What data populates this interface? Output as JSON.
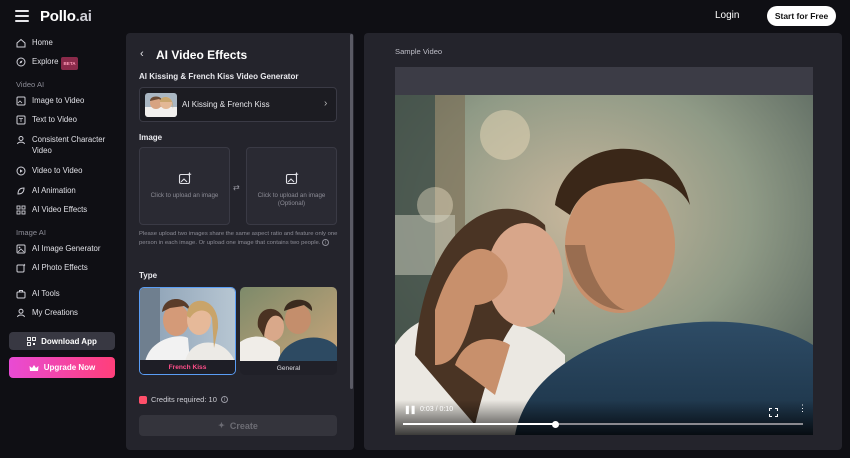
{
  "header": {
    "logo_main": "Pollo",
    "logo_tld": ".ai",
    "login": "Login",
    "start": "Start for Free"
  },
  "sidebar": {
    "home": "Home",
    "explore": "Explore",
    "beta": "BETA",
    "video_ai_label": "Video AI",
    "video_items": [
      "Image to Video",
      "Text to Video",
      "Consistent Character",
      "Video",
      "Video to Video",
      "AI Animation",
      "AI Video Effects"
    ],
    "image_ai_label": "Image AI",
    "image_items": [
      "AI Image Generator",
      "AI Photo Effects"
    ],
    "ai_tools": "AI Tools",
    "my_creations": "My Creations",
    "download": "Download App",
    "upgrade": "Upgrade Now"
  },
  "panel": {
    "back_icon": "‹",
    "title": "AI Video Effects",
    "generator_title": "AI Kissing & French Kiss Video Generator",
    "selector_label": "AI Kissing & French Kiss",
    "image_label": "Image",
    "upload1": "Click to upload an image",
    "upload2_line1": "Click to upload an image",
    "upload2_line2": "(Optional)",
    "hint": "Please upload two images share the same aspect ratio and feature only one person in each image. Or upload one image that contains two people.",
    "type_label": "Type",
    "types": [
      "French Kiss",
      "General"
    ],
    "selected_type": "French Kiss",
    "credits": "Credits required: 10",
    "create": "Create"
  },
  "sample": {
    "label": "Sample Video",
    "time": "0:03 / 0:10",
    "progress": 0.38
  },
  "colors": {
    "accent_pink": "#ff4f8a",
    "upgrade_gradient_start": "#e84bd4",
    "upgrade_gradient_end": "#ff3f7a",
    "selected_border": "#5a9df5"
  }
}
